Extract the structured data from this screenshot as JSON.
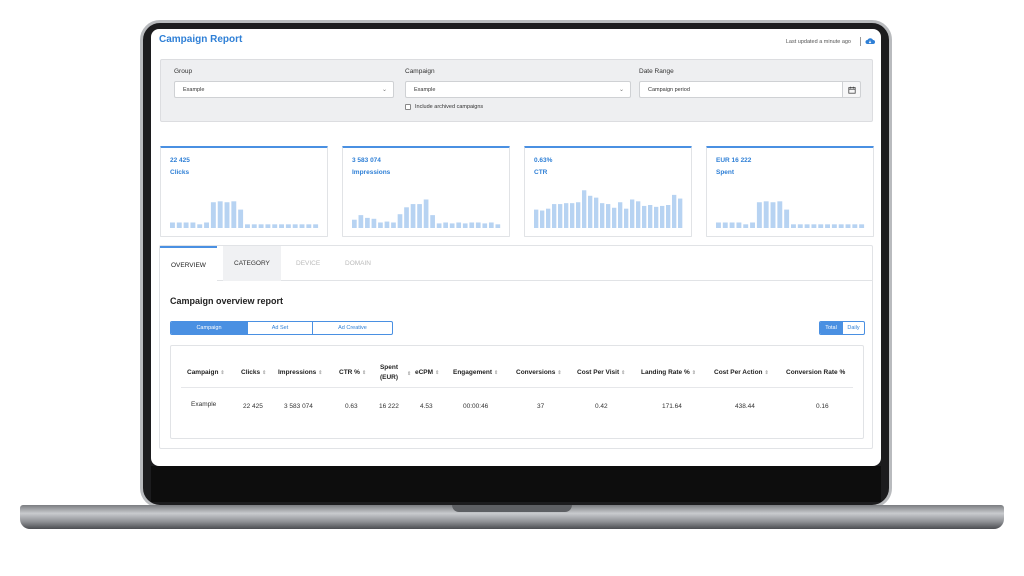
{
  "header": {
    "title": "Campaign Report",
    "last_updated": "Last updated a minute ago"
  },
  "filters": {
    "group_label": "Group",
    "group_value": "Example",
    "campaign_label": "Campaign",
    "campaign_value": "Example",
    "date_label": "Date Range",
    "date_value": "Campaign period",
    "include_archived_label": "Include archived campaigns"
  },
  "kpis": [
    {
      "value": "22 425",
      "label": "Clicks",
      "bars": [
        0.12,
        0.12,
        0.12,
        0.12,
        0.08,
        0.12,
        0.56,
        0.58,
        0.56,
        0.58,
        0.4,
        0.08,
        0.08,
        0.08,
        0.08,
        0.08,
        0.08,
        0.08,
        0.08,
        0.08,
        0.08,
        0.08
      ]
    },
    {
      "value": "3 583 074",
      "label": "Impressions",
      "bars": [
        0.18,
        0.28,
        0.22,
        0.2,
        0.12,
        0.14,
        0.12,
        0.3,
        0.45,
        0.52,
        0.52,
        0.62,
        0.28,
        0.1,
        0.12,
        0.1,
        0.12,
        0.1,
        0.12,
        0.12,
        0.1,
        0.12,
        0.08
      ]
    },
    {
      "value": "0.63%",
      "label": "CTR",
      "bars": [
        0.4,
        0.38,
        0.42,
        0.52,
        0.52,
        0.54,
        0.54,
        0.56,
        0.82,
        0.7,
        0.66,
        0.54,
        0.52,
        0.44,
        0.56,
        0.42,
        0.62,
        0.58,
        0.48,
        0.5,
        0.46,
        0.48,
        0.5,
        0.72,
        0.64
      ]
    },
    {
      "value": "EUR 16 222",
      "label": "Spent",
      "bars": [
        0.12,
        0.12,
        0.12,
        0.12,
        0.08,
        0.12,
        0.56,
        0.58,
        0.56,
        0.58,
        0.4,
        0.08,
        0.08,
        0.08,
        0.08,
        0.08,
        0.08,
        0.08,
        0.08,
        0.08,
        0.08,
        0.08
      ]
    }
  ],
  "tabs": [
    "OVERVIEW",
    "CATEGORY",
    "DEVICE",
    "DOMAIN"
  ],
  "report": {
    "title": "Campaign overview report",
    "segments": [
      "Campaign",
      "Ad Set",
      "Ad Creative"
    ],
    "toggle": [
      "Total",
      "Daily"
    ],
    "columns": [
      "Campaign",
      "Clicks",
      "Impressions",
      "CTR %",
      "Spent (EUR)",
      "eCPM",
      "Engagement",
      "Conversions",
      "Cost Per Visit",
      "Landing Rate %",
      "Cost Per Action",
      "Conversion Rate %"
    ],
    "rows": [
      [
        "Example",
        "22 425",
        "3 583 074",
        "0.63",
        "16 222",
        "4.53",
        "00:00:46",
        "37",
        "0.42",
        "171.64",
        "438.44",
        "0.16"
      ]
    ]
  },
  "colors": {
    "accent": "#4a90e2",
    "bar": "#b7d3f2"
  }
}
